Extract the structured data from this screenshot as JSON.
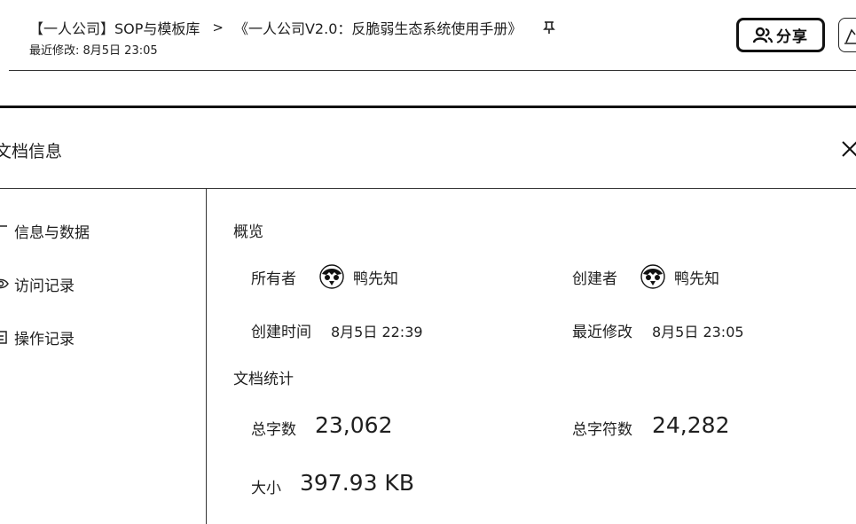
{
  "header": {
    "breadcrumb_root": "【一人公司】SOP与模板库",
    "breadcrumb_separator": ">",
    "doc_title": "《一人公司V2.0：反脆弱生态系统使用手册》",
    "modified_text": "最近修改: 8月5日 23:05",
    "share_label": "分享",
    "pin_icon": "pin-icon",
    "share_icon": "users-icon"
  },
  "dialog": {
    "title": "文档信息",
    "close_icon": "close-icon",
    "nav": [
      {
        "label": "信息与数据",
        "icon": "chart-icon"
      },
      {
        "label": "访问记录",
        "icon": "eye-icon"
      },
      {
        "label": "操作记录",
        "icon": "history-icon"
      }
    ]
  },
  "overview": {
    "title": "概览",
    "owner_label": "所有者",
    "owner_name": "鸭先知",
    "creator_label": "创建者",
    "creator_name": "鸭先知",
    "created_label": "创建时间",
    "created_value": "8月5日 22:39",
    "modified_label": "最近修改",
    "modified_value": "8月5日 23:05"
  },
  "stats": {
    "title": "文档统计",
    "words_label": "总字数",
    "words_value": "23,062",
    "chars_label": "总字符数",
    "chars_value": "24,282",
    "size_label": "大小",
    "size_value": "397.93 KB"
  }
}
